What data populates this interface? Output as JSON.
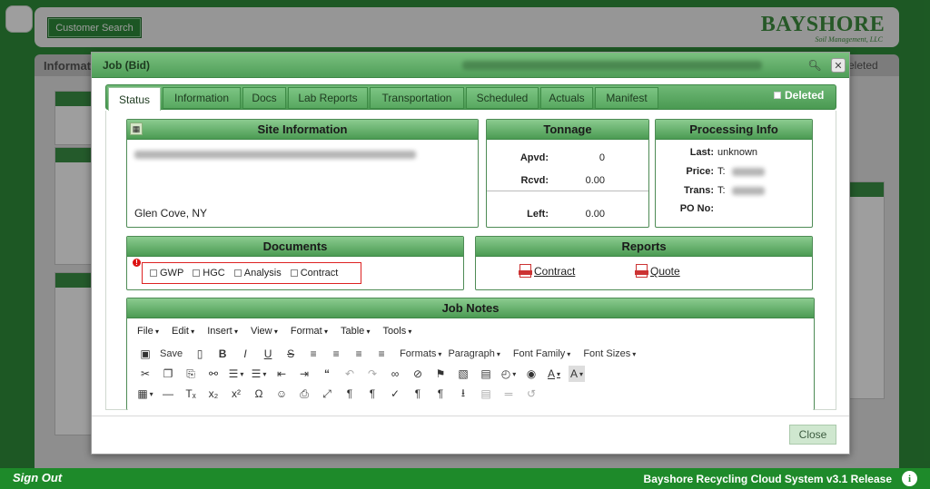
{
  "background": {
    "customer_search_label": "Customer Search",
    "logo_main": "BAYSHORE",
    "logo_sub": "Soil Management, LLC",
    "tab_left_label": "Informat",
    "tab_right_label": "eleted"
  },
  "modal": {
    "title": "Job (Bid)",
    "tabs": [
      {
        "label": "Status"
      },
      {
        "label": "Information"
      },
      {
        "label": "Docs"
      },
      {
        "label": "Lab Reports"
      },
      {
        "label": "Transportation"
      },
      {
        "label": "Scheduled"
      },
      {
        "label": "Actuals"
      },
      {
        "label": "Manifest"
      }
    ],
    "deleted_label": "Deleted",
    "site_info": {
      "header": "Site Information",
      "location": "Glen Cove, NY"
    },
    "tonnage": {
      "header": "Tonnage",
      "apvd_label": "Apvd:",
      "apvd_value": "0",
      "rcvd_label": "Rcvd:",
      "rcvd_value": "0.00",
      "left_label": "Left:",
      "left_value": "0.00"
    },
    "processing": {
      "header": "Processing Info",
      "last_label": "Last:",
      "last_value": "unknown",
      "price_label": "Price:",
      "price_value": "T:",
      "trans_label": "Trans:",
      "trans_value": "T:",
      "po_label": "PO No:"
    },
    "documents": {
      "header": "Documents",
      "items": [
        "GWP",
        "HGC",
        "Analysis",
        "Contract"
      ]
    },
    "reports": {
      "header": "Reports",
      "contract": "Contract",
      "quote": "Quote"
    },
    "job_notes": {
      "header": "Job Notes",
      "menu": [
        "File",
        "Edit",
        "Insert",
        "View",
        "Format",
        "Table",
        "Tools"
      ],
      "save_label": "Save",
      "formats_label": "Formats",
      "paragraph_label": "Paragraph",
      "font_family_label": "Font Family",
      "font_sizes_label": "Font Sizes"
    },
    "close_label": "Close"
  },
  "footer": {
    "sign_out": "Sign Out",
    "release": "Bayshore Recycling Cloud System v3.1 Release"
  }
}
